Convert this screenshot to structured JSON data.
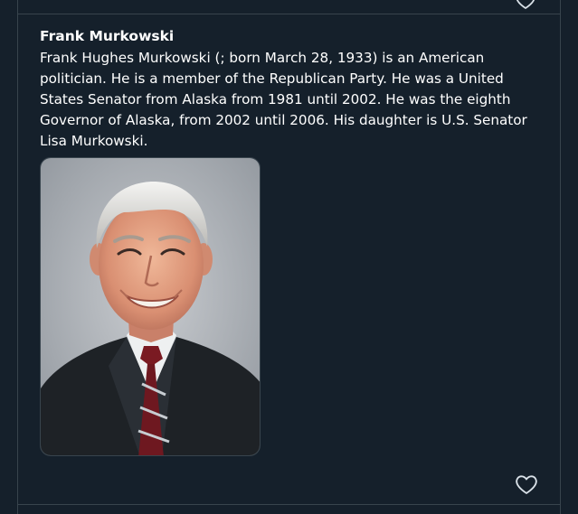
{
  "post": {
    "title": "Frank Murkowski",
    "body": "Frank Hughes Murkowski (; born March 28, 1933) is an American politician. He is a member of the Republican Party. He was a United States Senator from Alaska from 1981 until 2002. He was the eighth Governor of Alaska, from 2002 until 2006. His daughter is U.S. Senator Lisa Murkowski.",
    "image_alt": "Frank Murkowski portrait",
    "like_icon": "heart-outline-icon"
  },
  "colors": {
    "background": "#15202b",
    "border": "#38444d",
    "text": "#ffffff",
    "icon": "#d9e1e8"
  }
}
